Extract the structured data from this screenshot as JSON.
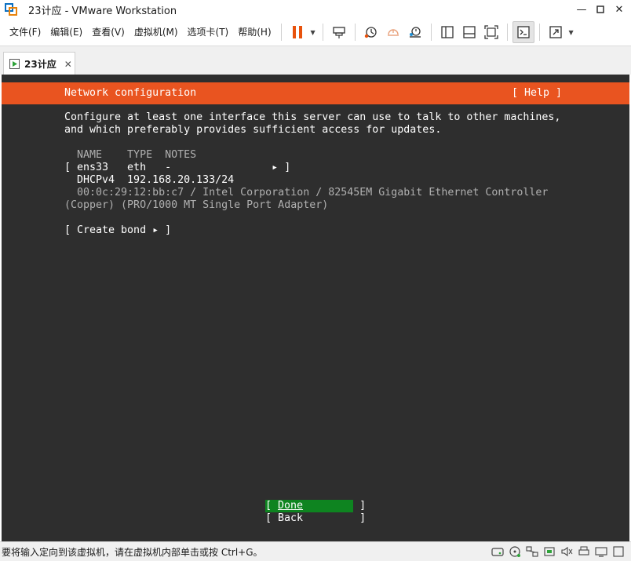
{
  "window": {
    "title": "23计应 - VMware Workstation",
    "minimize_glyph": "—",
    "maximize_glyph": "◻",
    "close_glyph": "✕"
  },
  "menu": [
    {
      "label": "文件(F)"
    },
    {
      "label": "编辑(E)"
    },
    {
      "label": "查看(V)"
    },
    {
      "label": "虚拟机(M)"
    },
    {
      "label": "选项卡(T)"
    },
    {
      "label": "帮助(H)"
    }
  ],
  "toolbar": {
    "icons": [
      "pause-icon",
      "send-ctrl-alt-del-icon",
      "snapshot-icon",
      "revert-snapshot-icon",
      "snapshot-manager-icon",
      "sidebar-icon",
      "thumbnail-icon",
      "fullscreen-fit-icon",
      "console-view-icon",
      "stretch-icon"
    ],
    "accent": "#e8520c"
  },
  "tab": {
    "label": "23计应",
    "close": "✕"
  },
  "console": {
    "header_title": "Network configuration",
    "header_help": "[ Help ]",
    "intro_line1": "Configure at least one interface this server can use to talk to other machines,",
    "intro_line2": "and which preferably provides sufficient access for updates.",
    "columns_line": "  NAME    TYPE  NOTES",
    "iface_line": "[ ens33   eth   -                ▸ ]",
    "dhcp_line": "  DHCPv4  192.168.20.133/24",
    "mac_line": "  00:0c:29:12:bb:c7 / Intel Corporation / 82545EM Gigabit Ethernet Controller",
    "adapter_line": "(Copper) (PRO/1000 MT Single Port Adapter)",
    "create_bond": "[ Create bond ▸ ]",
    "done_prefix": "[ ",
    "done_label": "Done",
    "done_suffix": "         ]",
    "back_label": "[ Back         ]",
    "header_color": "#e95420",
    "done_color": "#0e8420"
  },
  "statusbar": {
    "message": "要将输入定向到该虚拟机，请在虚拟机内部单击或按 Ctrl+G。"
  }
}
